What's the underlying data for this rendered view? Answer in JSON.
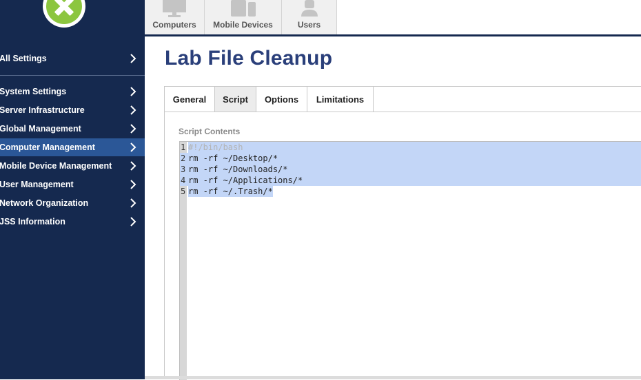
{
  "sidebar": {
    "items": [
      {
        "label": "All Settings"
      },
      {
        "label": "System Settings"
      },
      {
        "label": "Server Infrastructure"
      },
      {
        "label": "Global Management"
      },
      {
        "label": "Computer Management"
      },
      {
        "label": "Mobile Device Management"
      },
      {
        "label": "User Management"
      },
      {
        "label": "Network Organization"
      },
      {
        "label": "JSS Information"
      }
    ],
    "active_index": 4,
    "background_color": "#15294f",
    "active_color": "#2b5797",
    "logo_color": "#8cc63f"
  },
  "top_tabs": [
    {
      "label": "Computers",
      "icon": "monitor-icon"
    },
    {
      "label": "Mobile Devices",
      "icon": "mobile-devices-icon"
    },
    {
      "label": "Users",
      "icon": "user-icon"
    }
  ],
  "page": {
    "title": "Lab File Cleanup",
    "title_color": "#2a3f7a"
  },
  "content_tabs": [
    {
      "label": "General"
    },
    {
      "label": "Script"
    },
    {
      "label": "Options"
    },
    {
      "label": "Limitations"
    }
  ],
  "active_content_tab": "Script",
  "script": {
    "section_label": "Script Contents",
    "selection_color": "#c3d6f7",
    "lines": [
      {
        "num": "1",
        "text": "#!/bin/bash"
      },
      {
        "num": "2",
        "text": "rm -rf ~/Desktop/*"
      },
      {
        "num": "3",
        "text": "rm -rf ~/Downloads/*"
      },
      {
        "num": "4",
        "text": "rm -rf ~/Applications/*"
      },
      {
        "num": "5",
        "text": "rm -rf ~/.Trash/*"
      }
    ]
  }
}
